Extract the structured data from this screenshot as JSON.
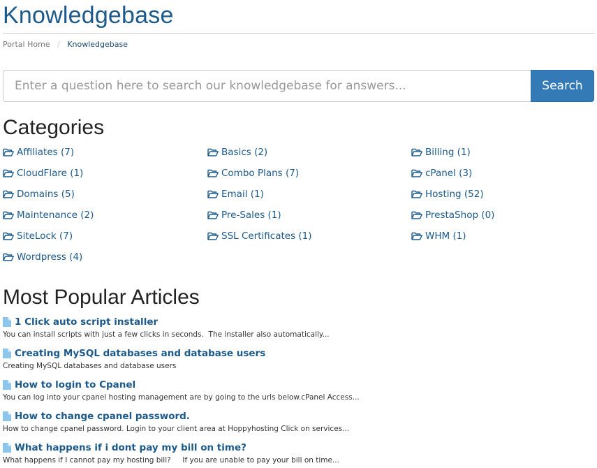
{
  "page": {
    "title": "Knowledgebase"
  },
  "breadcrumb": {
    "items": [
      "Portal Home",
      "Knowledgebase"
    ],
    "separator": "/"
  },
  "search": {
    "placeholder": "Enter a question here to search our knowledgebase for answers...",
    "value": "",
    "button_label": "Search"
  },
  "categories": {
    "heading": "Categories",
    "icon": "folder-open-icon",
    "items": [
      {
        "label": "Affiliates (7)"
      },
      {
        "label": "Basics (2)"
      },
      {
        "label": "Billing (1)"
      },
      {
        "label": "CloudFlare (1)"
      },
      {
        "label": "Combo Plans (7)"
      },
      {
        "label": "cPanel (3)"
      },
      {
        "label": "Domains (5)"
      },
      {
        "label": "Email (1)"
      },
      {
        "label": "Hosting (52)"
      },
      {
        "label": "Maintenance (2)"
      },
      {
        "label": "Pre-Sales (1)"
      },
      {
        "label": "PrestaShop (0)"
      },
      {
        "label": "SiteLock (7)"
      },
      {
        "label": "SSL Certificates (1)"
      },
      {
        "label": "WHM (1)"
      },
      {
        "label": "Wordpress (4)"
      }
    ]
  },
  "popular": {
    "heading": "Most Popular Articles",
    "icon": "file-icon",
    "articles": [
      {
        "title": "1 Click auto script installer",
        "snippet": "You can install scripts with just a few clicks in seconds.  The installer also automatically..."
      },
      {
        "title": "Creating MySQL databases and database users",
        "snippet": "Creating MySQL databases and database users"
      },
      {
        "title": "How to login to Cpanel",
        "snippet": "You can log into your cpanel hosting management are by going to the urls below.cPanel Access..."
      },
      {
        "title": "How to change cpanel password.",
        "snippet": "How to change cpanel password. Login to your client area at Hoppyhosting Click on services..."
      },
      {
        "title": "What happens if i dont pay my bill on time?",
        "snippet": "What happens if I cannot pay my hosting bill?     If you are unable to pay your bill on time..."
      }
    ]
  },
  "colors": {
    "link": "#1c5a8c",
    "button": "#337ab7",
    "file_icon": "#8ec5ea"
  }
}
